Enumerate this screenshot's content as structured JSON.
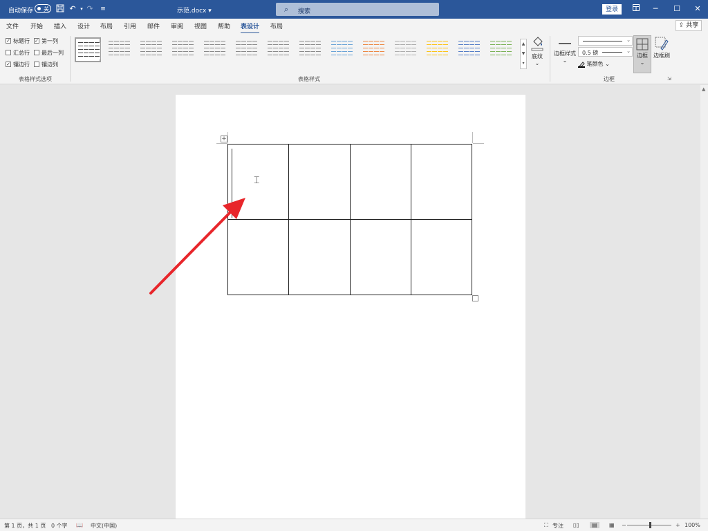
{
  "titlebar": {
    "autosave_label": "自动保存",
    "autosave_state": "关",
    "filename": "示范.docx ▾",
    "search_placeholder": "搜索",
    "login_label": "登录",
    "icons": [
      "save-icon",
      "undo-icon",
      "redo-icon",
      "customize-icon"
    ]
  },
  "tabs": [
    {
      "label": "文件"
    },
    {
      "label": "开始"
    },
    {
      "label": "插入"
    },
    {
      "label": "设计"
    },
    {
      "label": "布局"
    },
    {
      "label": "引用"
    },
    {
      "label": "邮件"
    },
    {
      "label": "审阅"
    },
    {
      "label": "视图"
    },
    {
      "label": "帮助"
    },
    {
      "label": "表设计",
      "active": true
    },
    {
      "label": "布局"
    }
  ],
  "share_label": "共享",
  "ribbon": {
    "style_options": {
      "items": [
        {
          "label": "标题行",
          "checked": true
        },
        {
          "label": "第一列",
          "checked": true
        },
        {
          "label": "汇总行",
          "checked": false
        },
        {
          "label": "最后一列",
          "checked": false
        },
        {
          "label": "镶边行",
          "checked": true
        },
        {
          "label": "镶边列",
          "checked": false
        }
      ],
      "group_label": "表格样式选项"
    },
    "table_styles": {
      "group_label": "表格样式",
      "thumb_colors": [
        "#333333",
        "#7f7f7f",
        "#7f7f7f",
        "#7f7f7f",
        "#7f7f7f",
        "#7f7f7f",
        "#7f7f7f",
        "#5b9bd5",
        "#ed7d31",
        "#a5a5a5",
        "#ffc000",
        "#4472c4",
        "#70ad47"
      ]
    },
    "shading_label": "底纹",
    "border_styles_label": "边框样式",
    "pen_weight": "0.5 磅",
    "pen_color_label": "笔颜色",
    "borders_label": "边框",
    "border_painter_label": "边框刷",
    "borders_group_label": "边框"
  },
  "statusbar": {
    "page": "第 1 页，共 1 页",
    "words": "0 个字",
    "language": "中文(中国)",
    "focus": "专注",
    "zoom": "100%"
  },
  "annotation": {
    "arrow_color": "#e8262b"
  }
}
